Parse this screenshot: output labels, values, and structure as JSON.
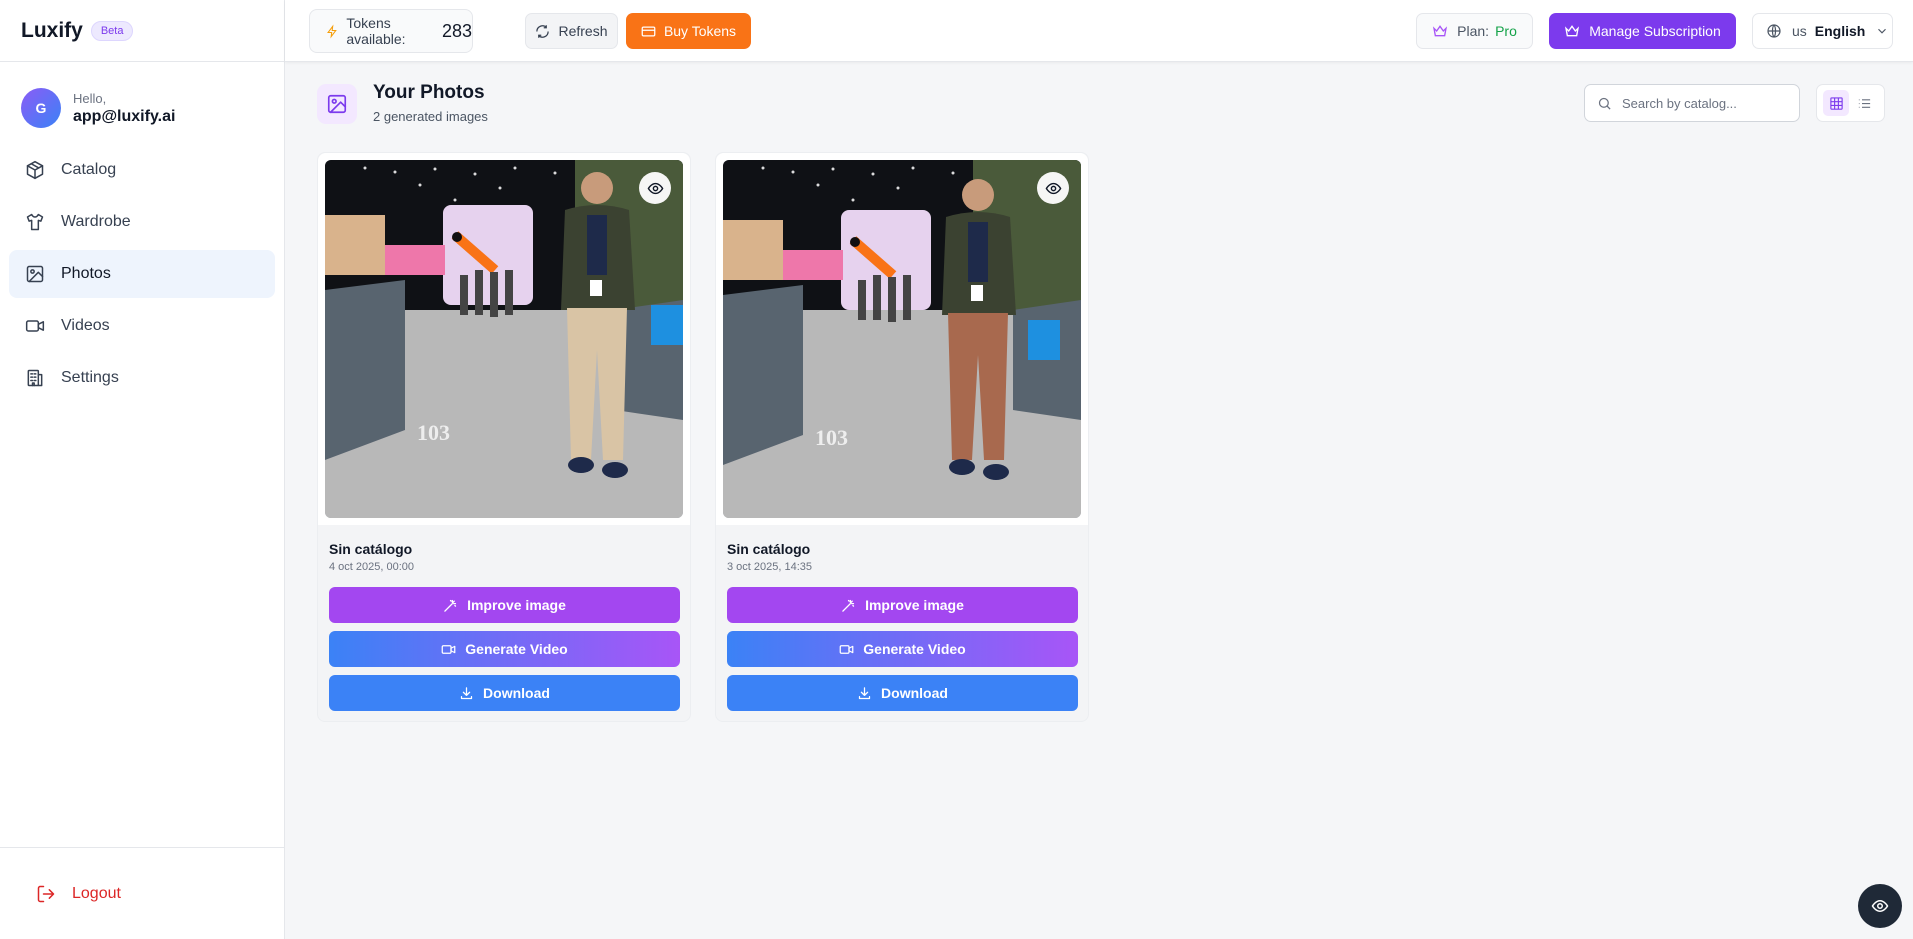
{
  "brand": {
    "name": "Luxify",
    "badge": "Beta"
  },
  "user": {
    "initial": "G",
    "greeting": "Hello,",
    "email": "app@luxify.ai"
  },
  "nav": {
    "catalog": "Catalog",
    "wardrobe": "Wardrobe",
    "photos": "Photos",
    "videos": "Videos",
    "settings": "Settings"
  },
  "logout": "Logout",
  "topbar": {
    "tokens_label": "Tokens available:",
    "tokens_value": "283",
    "refresh": "Refresh",
    "buy": "Buy Tokens",
    "plan_label": "Plan:",
    "plan_value": "Pro",
    "manage": "Manage Subscription",
    "lang_code": "us",
    "lang_name": "English"
  },
  "header": {
    "title": "Your Photos",
    "subtitle": "2 generated images",
    "search_placeholder": "Search by catalog..."
  },
  "cards": [
    {
      "title": "Sin catálogo",
      "date": "4 oct 2025, 00:00",
      "improve": "Improve image",
      "video": "Generate Video",
      "download": "Download",
      "pants_color": "#d9c4a5"
    },
    {
      "title": "Sin catálogo",
      "date": "3 oct 2025, 14:35",
      "improve": "Improve image",
      "video": "Generate Video",
      "download": "Download",
      "pants_color": "#a8694e"
    }
  ],
  "colors": {
    "accent": "#7c3aed",
    "orange": "#f97316",
    "blue": "#3b82f6",
    "active_nav": "#eef4fd"
  }
}
